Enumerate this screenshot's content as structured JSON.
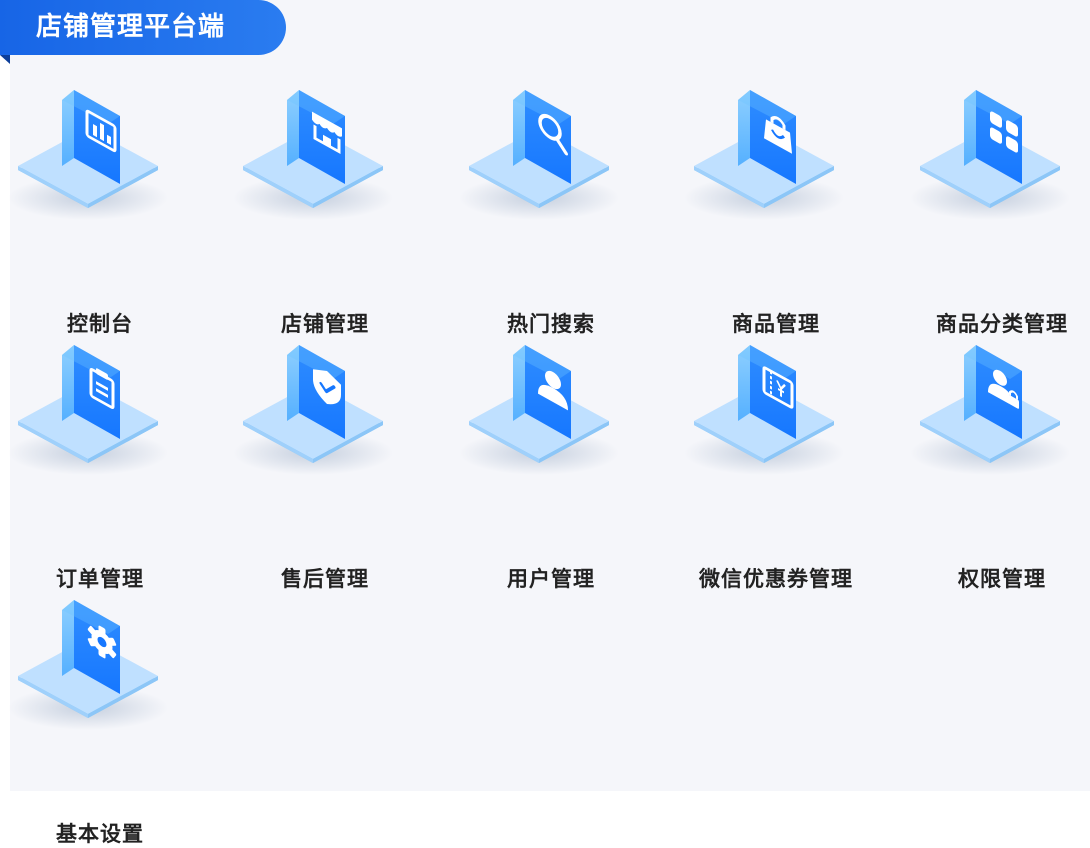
{
  "header": {
    "title": "店铺管理平台端"
  },
  "colors": {
    "accent": "#1765e6",
    "tile_base": "#bfe0ff",
    "icon_front": "#1677ff",
    "icon_side": "#55b0ff"
  },
  "menu": {
    "items": [
      {
        "id": "dashboard",
        "label": "控制台",
        "icon": "bar-chart-icon"
      },
      {
        "id": "store-management",
        "label": "店铺管理",
        "icon": "storefront-icon"
      },
      {
        "id": "hot-search",
        "label": "热门搜索",
        "icon": "search-icon"
      },
      {
        "id": "product-management",
        "label": "商品管理",
        "icon": "shopping-bag-icon"
      },
      {
        "id": "category-management",
        "label": "商品分类管理",
        "icon": "grid-icon"
      },
      {
        "id": "order-management",
        "label": "订单管理",
        "icon": "clipboard-icon"
      },
      {
        "id": "after-sales-management",
        "label": "售后管理",
        "icon": "shield-check-icon"
      },
      {
        "id": "user-management",
        "label": "用户管理",
        "icon": "user-icon"
      },
      {
        "id": "wechat-coupon-management",
        "label": "微信优惠券管理",
        "icon": "coupon-icon"
      },
      {
        "id": "permission-management",
        "label": "权限管理",
        "icon": "user-lock-icon"
      },
      {
        "id": "basic-settings",
        "label": "基本设置",
        "icon": "gear-icon"
      }
    ]
  }
}
